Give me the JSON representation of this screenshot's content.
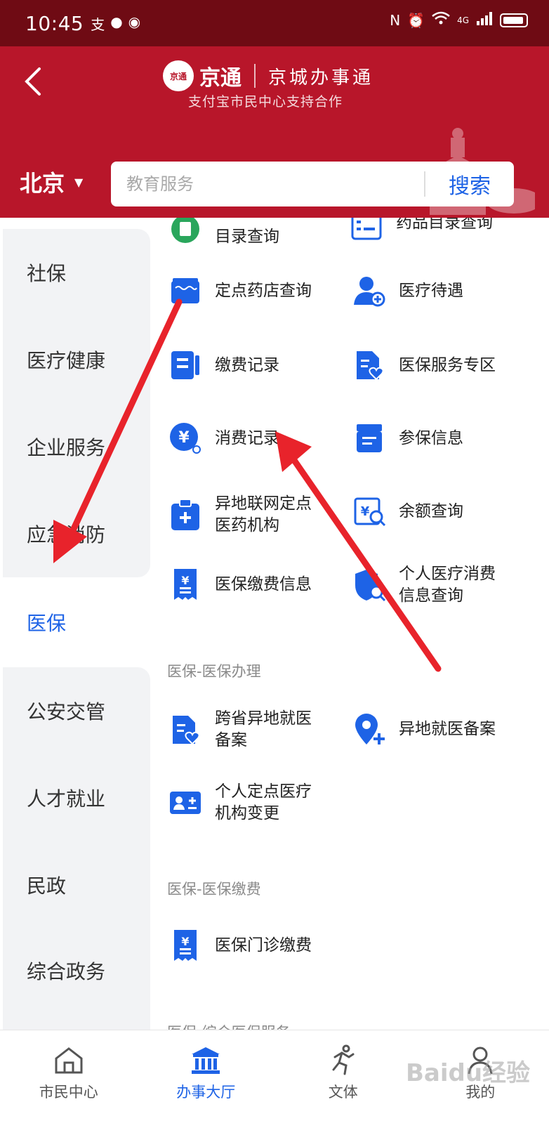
{
  "status_bar": {
    "time": "10:45",
    "network": "4G"
  },
  "header": {
    "back_icon": "back-arrow-icon",
    "brand_logo_text": "京通",
    "brand_name": "京通",
    "brand_slogan": "京城办事通",
    "brand_subtitle": "支付宝市民中心支持合作"
  },
  "city": {
    "label": "北京"
  },
  "search": {
    "placeholder": "教育服务",
    "button_label": "搜索"
  },
  "sidebar": {
    "items": [
      {
        "label": "社保"
      },
      {
        "label": "医疗健康"
      },
      {
        "label": "企业服务"
      },
      {
        "label": "应急消防"
      },
      {
        "label": "医保",
        "active": true
      },
      {
        "label": "公安交管"
      },
      {
        "label": "人才就业"
      },
      {
        "label": "民政"
      },
      {
        "label": "综合政务"
      }
    ]
  },
  "services": [
    {
      "label": "目录查询",
      "icon": "catalog-icon"
    },
    {
      "label": "药品目录查询",
      "icon": "drug-list-icon"
    },
    {
      "label": "定点药店查询",
      "icon": "pharmacy-icon"
    },
    {
      "label": "医疗待遇",
      "icon": "medical-user-icon"
    },
    {
      "label": "缴费记录",
      "icon": "receipt-icon"
    },
    {
      "label": "医保服务专区",
      "icon": "doc-heart-icon"
    },
    {
      "label": "消费记录",
      "icon": "yuan-search-icon"
    },
    {
      "label": "参保信息",
      "icon": "list-doc-icon"
    },
    {
      "label": "异地联网定点医药机构",
      "icon": "clipboard-plus-icon"
    },
    {
      "label": "余额查询",
      "icon": "balance-search-icon"
    },
    {
      "label": "医保缴费信息",
      "icon": "yuan-doc-icon"
    },
    {
      "label": "个人医疗消费信息查询",
      "icon": "shield-search-icon"
    }
  ],
  "section_handle": {
    "title": "医保-医保办理",
    "items": [
      {
        "label": "跨省异地就医备案",
        "icon": "doc-heart-icon"
      },
      {
        "label": "异地就医备案",
        "icon": "location-plus-icon"
      },
      {
        "label": "个人定点医疗机构变更",
        "icon": "id-card-icon"
      }
    ]
  },
  "section_pay": {
    "title": "医保-医保缴费",
    "items": [
      {
        "label": "医保门诊缴费",
        "icon": "yuan-doc-icon"
      }
    ]
  },
  "section_more": {
    "title": "医保-综合医保服务"
  },
  "bottom_nav": [
    {
      "label": "市民中心",
      "icon": "home-icon"
    },
    {
      "label": "办事大厅",
      "icon": "hall-icon",
      "active": true
    },
    {
      "label": "文体",
      "icon": "runner-icon"
    },
    {
      "label": "我的",
      "icon": "user-icon"
    }
  ],
  "watermark": "Baidu经验",
  "colors": {
    "header": "#b8162a",
    "status_bar": "#6f0b14",
    "accent": "#1e63e6",
    "arrow": "#e8232b"
  }
}
